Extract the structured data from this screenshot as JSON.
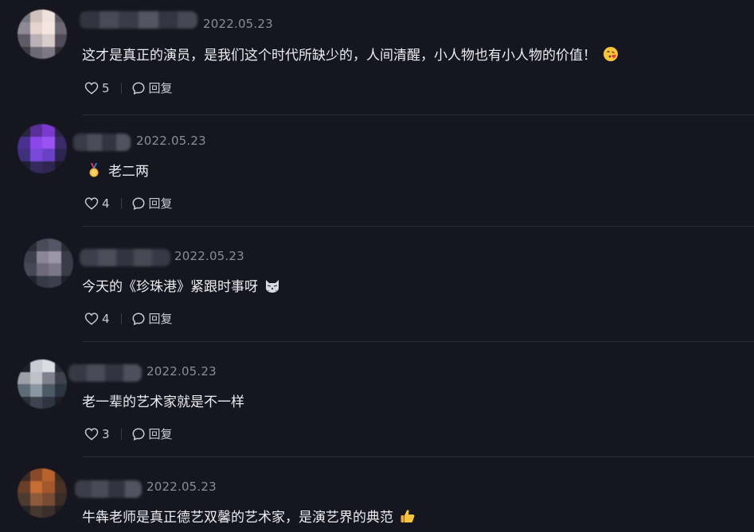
{
  "comments": [
    {
      "date": "2022.05.23",
      "text": "这才是真正的演员，是我们这个时代所缺少的，人间清醒，小人物也有小人物的价值！",
      "emoji": "blowing-kiss-emoji",
      "likes": "5",
      "reply_label": "回复"
    },
    {
      "date": "2022.05.23",
      "text": "老二两",
      "emoji": "medal-emoji",
      "likes": "4",
      "reply_label": "回复"
    },
    {
      "date": "2022.05.23",
      "text": "今天的《珍珠港》紧跟时事呀",
      "emoji": "cat-face-emoji",
      "likes": "4",
      "reply_label": "回复"
    },
    {
      "date": "2022.05.23",
      "text": "老一辈的艺术家就是不一样",
      "emoji": "",
      "likes": "3",
      "reply_label": "回复"
    },
    {
      "date": "2022.05.23",
      "text": "牛犇老师是真正德艺双馨的艺术家，是演艺界的典范",
      "emoji": "thumbs-up-emoji",
      "likes": "",
      "reply_label": ""
    }
  ],
  "colors": {
    "background": "#15161f",
    "text": "#ececf1",
    "meta": "#8b8c97"
  }
}
